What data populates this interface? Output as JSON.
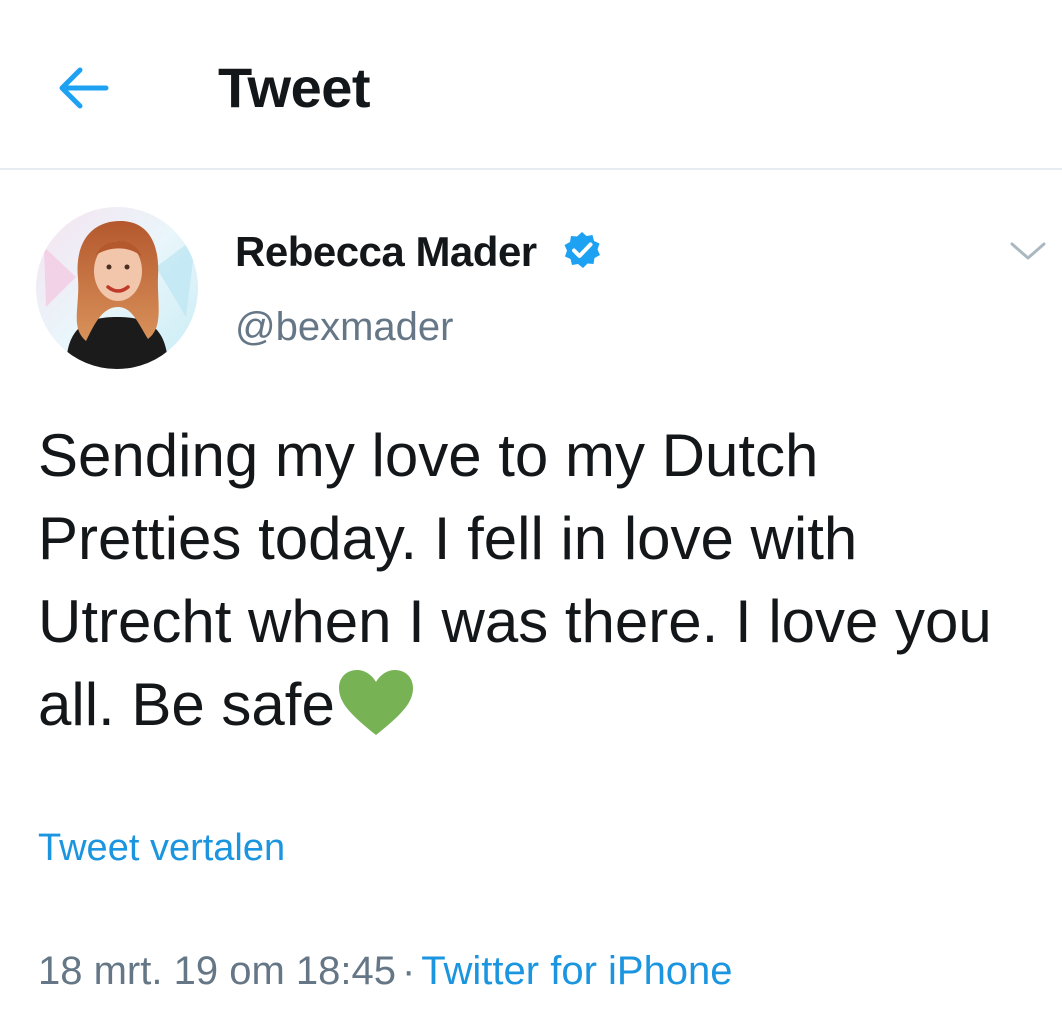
{
  "header": {
    "back_icon": "arrow-left-icon",
    "title": "Tweet"
  },
  "tweet": {
    "author": {
      "name": "Rebecca Mader",
      "handle": "@bexmader",
      "verified": true
    },
    "text": "Sending my love to my Dutch Pretties today. I fell in love with Utrecht when I was there. I love you all. Be safe",
    "emoji": "green-heart",
    "translate_link": "Tweet vertalen",
    "timestamp": "18 mrt. 19 om 18:45",
    "separator": "·",
    "source": "Twitter for iPhone"
  },
  "colors": {
    "accent": "#1b95e0",
    "text_primary": "#14171a",
    "text_secondary": "#657786",
    "verified_blue": "#1da1f2",
    "heart_green": "#77b255",
    "divider": "#e6ecf0"
  }
}
